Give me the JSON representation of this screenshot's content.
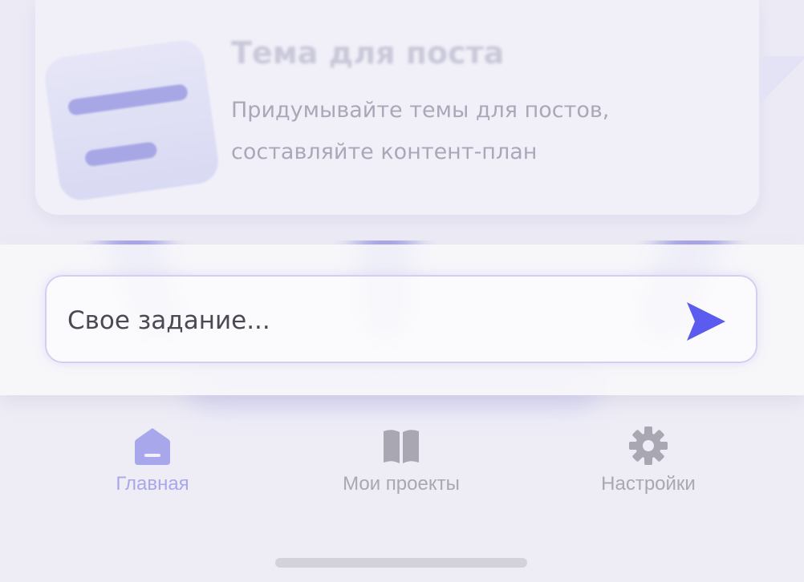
{
  "card": {
    "title": "Тема для поста",
    "description_line1": "Придумывайте темы для постов,",
    "description_line2": "составляйте контент-план"
  },
  "task_input": {
    "placeholder": "Свое задание...",
    "send_icon": "send-arrow-icon"
  },
  "tabbar": {
    "tabs": [
      {
        "label": "Главная",
        "icon": "home-icon",
        "active": true
      },
      {
        "label": "Мои проекты",
        "icon": "book-icon",
        "active": false
      },
      {
        "label": "Настройки",
        "icon": "gear-icon",
        "active": false
      }
    ]
  },
  "colors": {
    "accent": "#5b5bf0",
    "active_tab": "#a9a7ec",
    "inactive_tab": "#a8a7b2",
    "background": "#eeedf6"
  }
}
